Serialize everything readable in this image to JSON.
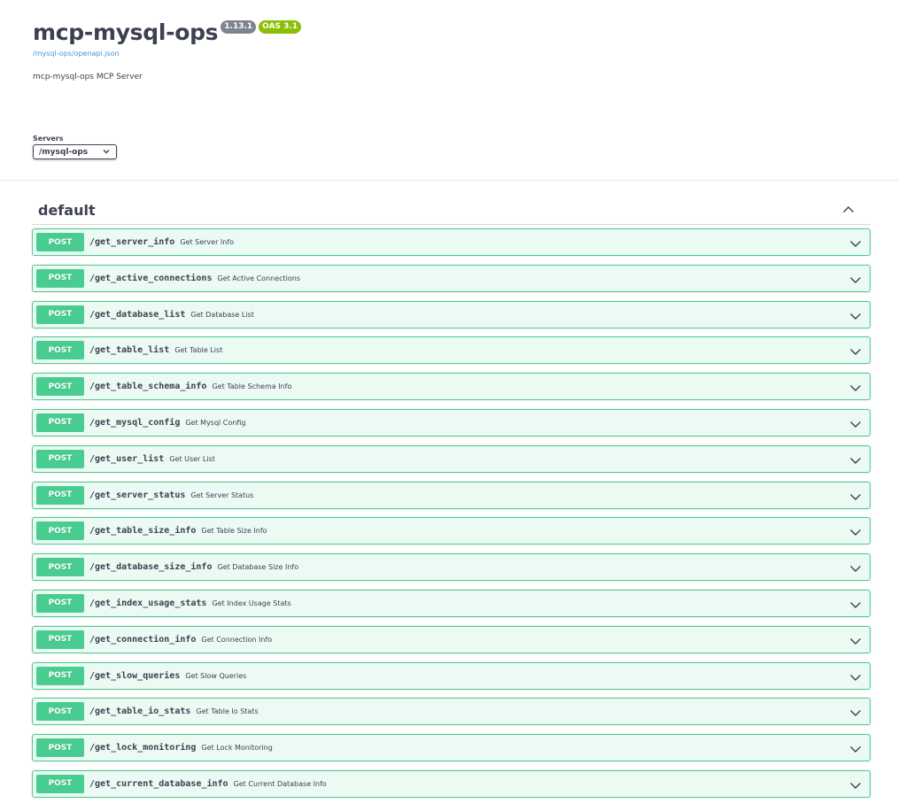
{
  "info": {
    "title": "mcp-mysql-ops",
    "version_badge": "1.13.1",
    "oas_badge": "OAS 3.1",
    "spec_link": "/mysql-ops/openapi.json",
    "description": "mcp-mysql-ops MCP Server"
  },
  "servers": {
    "label": "Servers",
    "selected": "/mysql-ops"
  },
  "tag": {
    "name": "default",
    "expanded": true
  },
  "colors": {
    "post": "#49cc90",
    "badge_version": "#7d8492",
    "badge_oas": "#89bf04",
    "link": "#4990e2",
    "text": "#3b4151"
  },
  "operations": [
    {
      "method": "POST",
      "path": "/get_server_info",
      "summary": "Get Server Info"
    },
    {
      "method": "POST",
      "path": "/get_active_connections",
      "summary": "Get Active Connections"
    },
    {
      "method": "POST",
      "path": "/get_database_list",
      "summary": "Get Database List"
    },
    {
      "method": "POST",
      "path": "/get_table_list",
      "summary": "Get Table List"
    },
    {
      "method": "POST",
      "path": "/get_table_schema_info",
      "summary": "Get Table Schema Info"
    },
    {
      "method": "POST",
      "path": "/get_mysql_config",
      "summary": "Get Mysql Config"
    },
    {
      "method": "POST",
      "path": "/get_user_list",
      "summary": "Get User List"
    },
    {
      "method": "POST",
      "path": "/get_server_status",
      "summary": "Get Server Status"
    },
    {
      "method": "POST",
      "path": "/get_table_size_info",
      "summary": "Get Table Size Info"
    },
    {
      "method": "POST",
      "path": "/get_database_size_info",
      "summary": "Get Database Size Info"
    },
    {
      "method": "POST",
      "path": "/get_index_usage_stats",
      "summary": "Get Index Usage Stats"
    },
    {
      "method": "POST",
      "path": "/get_connection_info",
      "summary": "Get Connection Info"
    },
    {
      "method": "POST",
      "path": "/get_slow_queries",
      "summary": "Get Slow Queries"
    },
    {
      "method": "POST",
      "path": "/get_table_io_stats",
      "summary": "Get Table Io Stats"
    },
    {
      "method": "POST",
      "path": "/get_lock_monitoring",
      "summary": "Get Lock Monitoring"
    },
    {
      "method": "POST",
      "path": "/get_current_database_info",
      "summary": "Get Current Database Info"
    }
  ]
}
